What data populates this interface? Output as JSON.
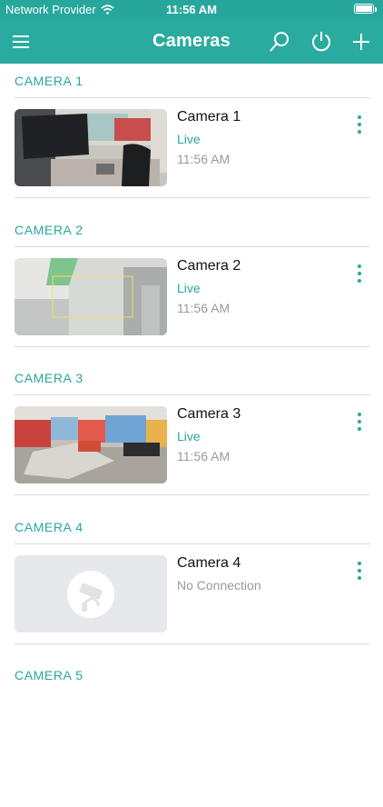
{
  "status_bar": {
    "carrier": "Network Provider",
    "time": "11:56 AM"
  },
  "nav": {
    "title": "Cameras",
    "icons": [
      "menu-icon",
      "search-icon",
      "power-icon",
      "add-icon"
    ]
  },
  "colors": {
    "accent": "#27a79c",
    "muted": "#9a9a9a"
  },
  "cameras": [
    {
      "section": "CAMERA 1",
      "name": "Camera 1",
      "status": "Live",
      "time": "11:56 AM"
    },
    {
      "section": "CAMERA 2",
      "name": "Camera 2",
      "status": "Live",
      "time": "11:56 AM"
    },
    {
      "section": "CAMERA 3",
      "name": "Camera 3",
      "status": "Live",
      "time": "11:56 AM"
    },
    {
      "section": "CAMERA 4",
      "name": "Camera 4",
      "status": "No Connection",
      "time": ""
    },
    {
      "section": "CAMERA 5"
    }
  ]
}
